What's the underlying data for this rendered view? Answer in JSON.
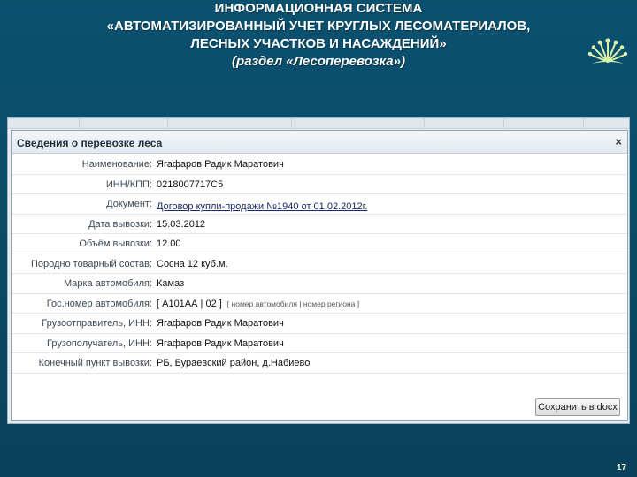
{
  "slide": {
    "title_line1": "ИНФОРМАЦИОННАЯ СИСТЕМА",
    "title_line2": "«АВТОМАТИЗИРОВАННЫЙ УЧЕТ КРУГЛЫХ ЛЕСОМАТЕРИАЛОВ,",
    "title_line3": "ЛЕСНЫХ УЧАСТКОВ И НАСАЖДЕНИЙ»",
    "subtitle": "(раздел «Лесоперевозка»)",
    "page_number": "17",
    "logo_icon": "bashkortostan-kurai-flower-icon"
  },
  "dialog": {
    "title": "Сведения о перевозке леса",
    "close_icon": "close-icon",
    "save_button_label": "Сохранить в docx",
    "fields": [
      {
        "label": "Наименование:",
        "value": "Ягафаров Радик Маратович"
      },
      {
        "label": "ИНН/КПП:",
        "value": "0218007717С5"
      },
      {
        "label": "Документ:",
        "value": "Договор купли-продажи №1940 от 01.02.2012г."
      },
      {
        "label": "Дата вывозки:",
        "value": "15.03.2012"
      },
      {
        "label": "Объём вывозки:",
        "value": "12.00"
      },
      {
        "label": "Породно товарный состав:",
        "value": "Сосна 12 куб.м."
      },
      {
        "label": "Марка автомобиля:",
        "value": "Камаз"
      },
      {
        "label": "Гос.номер автомобиля:",
        "value": "[ А101АА | 02 ]",
        "hint": "[ номер автомобиля | номер региона ]"
      },
      {
        "label": "Грузоотправитель, ИНН:",
        "value": "Ягафаров Радик Маратович"
      },
      {
        "label": "Грузополучатель, ИНН:",
        "value": "Ягафаров Радик Маратович"
      },
      {
        "label": "Конечный пункт вывозки:",
        "value": "РБ, Бураевский район, д.Набиево"
      }
    ]
  },
  "colors": {
    "background": "#0a4d6b",
    "title_text": "#ffffff",
    "logo": "#d9f2a8"
  }
}
